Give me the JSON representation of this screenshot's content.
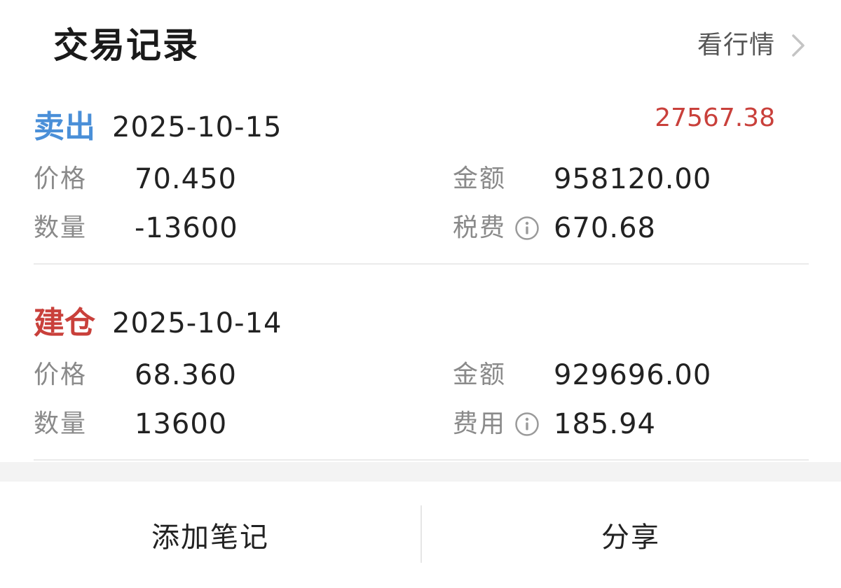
{
  "header": {
    "title": "交易记录",
    "market_link_label": "看行情"
  },
  "records": [
    {
      "type_label": "卖出",
      "type_color": "#4a8fd8",
      "date": "2025-10-15",
      "profit": "27567.38",
      "profit_color": "#c9403b",
      "price_label": "价格",
      "price": "70.450",
      "amount_label": "金额",
      "amount": "958120.00",
      "quantity_label": "数量",
      "quantity": "-13600",
      "fee_label": "税费",
      "fee": "670.68",
      "fee_icon": "info-icon"
    },
    {
      "type_label": "建仓",
      "type_color": "#c9403b",
      "date": "2025-10-14",
      "price_label": "价格",
      "price": "68.360",
      "amount_label": "金额",
      "amount": "929696.00",
      "quantity_label": "数量",
      "quantity": "13600",
      "fee_label": "费用",
      "fee": "185.94",
      "fee_icon": "info-icon"
    }
  ],
  "footer": {
    "add_note_label": "添加笔记",
    "share_label": "分享"
  }
}
